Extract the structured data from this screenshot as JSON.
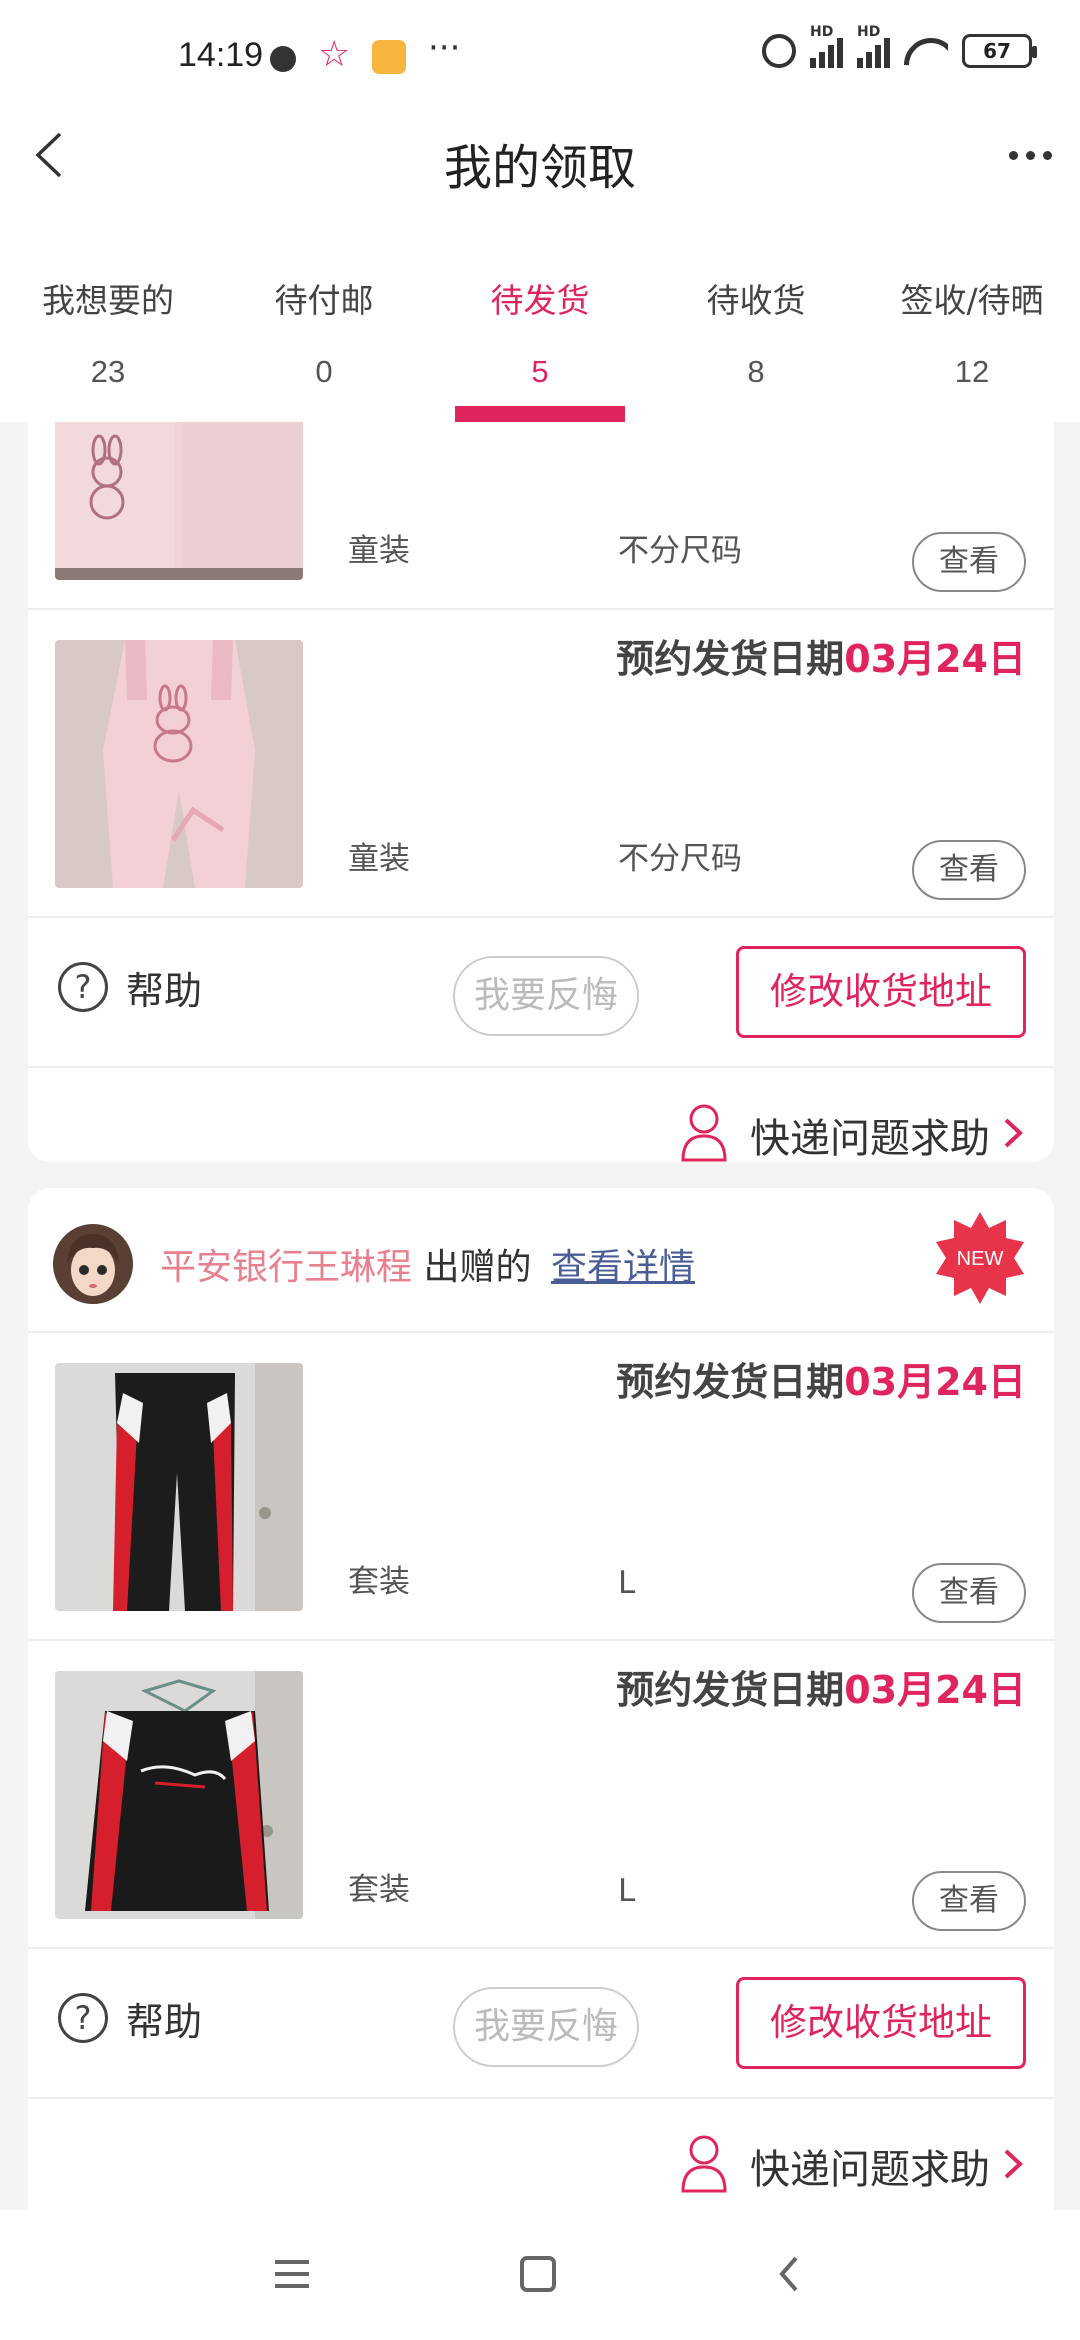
{
  "status_bar": {
    "time": "14:19",
    "more": "···",
    "battery": "67",
    "hd1": "HD",
    "hd2": "HD"
  },
  "header": {
    "title": "我的领取"
  },
  "tabs": [
    {
      "label": "我想要的",
      "count": "23"
    },
    {
      "label": "待付邮",
      "count": "0"
    },
    {
      "label": "待发货",
      "count": "5",
      "active": true
    },
    {
      "label": "待收货",
      "count": "8"
    },
    {
      "label": "签收/待晒",
      "count": "12"
    }
  ],
  "card1": {
    "items": [
      {
        "date_prefix": "",
        "date": "",
        "category": "童装",
        "size": "不分尺码",
        "view": "查看"
      },
      {
        "date_prefix": "预约发货日期",
        "date": "03月24日",
        "category": "童装",
        "size": "不分尺码",
        "view": "查看"
      }
    ],
    "help": "帮助",
    "help_icon": "?",
    "regret": "我要反悔",
    "modify_address": "修改收货地址",
    "express_help": "快递问题求助"
  },
  "card2": {
    "donor_name": "平安银行王琳程",
    "donor_suffix": "出赠的",
    "detail_link": "查看详情",
    "new_badge": "NEW",
    "items": [
      {
        "date_prefix": "预约发货日期",
        "date": "03月24日",
        "category": "套装",
        "size": "L",
        "view": "查看"
      },
      {
        "date_prefix": "预约发货日期",
        "date": "03月24日",
        "category": "套装",
        "size": "L",
        "view": "查看"
      }
    ],
    "help": "帮助",
    "help_icon": "?",
    "regret": "我要反悔",
    "modify_address": "修改收货地址",
    "express_help": "快递问题求助"
  },
  "colors": {
    "accent": "#e0245e",
    "donor": "#e9808f",
    "link": "#4a5d96"
  }
}
